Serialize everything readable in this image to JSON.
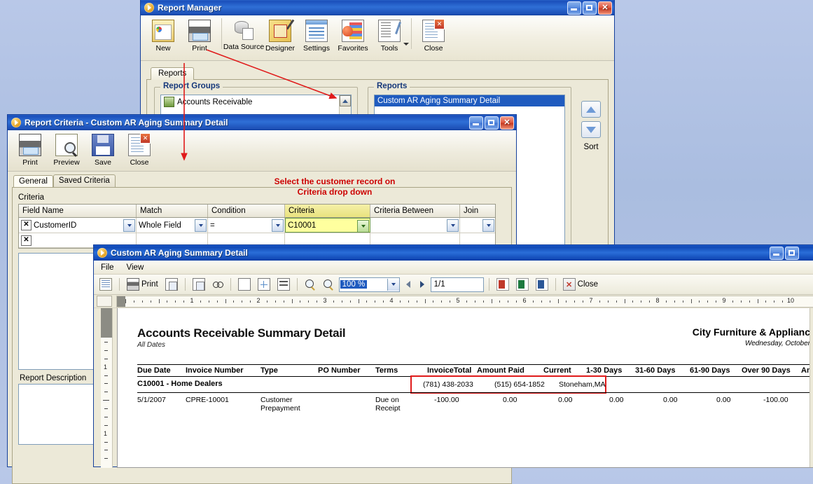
{
  "report_manager": {
    "title": "Report Manager",
    "toolbar": [
      {
        "label": "New",
        "icon": "new-report-icon"
      },
      {
        "label": "Print",
        "icon": "printer-icon"
      },
      {
        "label": "Data Source",
        "icon": "database-icon"
      },
      {
        "label": "Designer",
        "icon": "designer-icon"
      },
      {
        "label": "Settings",
        "icon": "settings-icon"
      },
      {
        "label": "Favorites",
        "icon": "favorites-icon"
      },
      {
        "label": "Tools",
        "icon": "tools-icon"
      },
      {
        "label": "Close",
        "icon": "close-document-icon"
      }
    ],
    "tab": "Reports",
    "report_groups": {
      "legend": "Report Groups",
      "items": [
        "Accounts Receivable"
      ]
    },
    "reports": {
      "legend": "Reports",
      "items": [
        "Custom AR Aging Summary Detail"
      ],
      "selected": "Custom AR Aging Summary Detail"
    },
    "sort_label": "Sort"
  },
  "report_criteria": {
    "title": "Report Criteria - Custom AR Aging Summary Detail",
    "toolbar": [
      {
        "label": "Print",
        "icon": "printer-icon"
      },
      {
        "label": "Preview",
        "icon": "preview-magnifier-icon"
      },
      {
        "label": "Save",
        "icon": "floppy-disk-icon"
      },
      {
        "label": "Close",
        "icon": "close-document-icon"
      }
    ],
    "tabs": [
      {
        "label": "General",
        "active": true
      },
      {
        "label": "Saved Criteria",
        "active": false
      }
    ],
    "annotation": "Select the customer record on\nCriteria drop down",
    "criteria_label": "Criteria",
    "grid": {
      "headers": [
        "Field Name",
        "Match",
        "Condition",
        "Criteria",
        "Criteria Between",
        "Join"
      ],
      "highlight_header": "Criteria",
      "rows": [
        {
          "field_name": "CustomerID",
          "match": "Whole Field",
          "condition": "=",
          "criteria": "C10001",
          "criteria_between": "",
          "join": ""
        },
        {
          "field_name": "",
          "match": "",
          "condition": "",
          "criteria": "",
          "criteria_between": "",
          "join": ""
        }
      ]
    },
    "description_label": "Report Description"
  },
  "report_viewer": {
    "title": "Custom AR Aging Summary Detail",
    "menu": [
      "File",
      "View"
    ],
    "toolbar": {
      "print_label": "Print",
      "zoom_value": "100 %",
      "page_value": "1/1",
      "close_label": "Close",
      "icons": [
        "document-outline-icon",
        "printer-icon",
        "page-setup-icon",
        "copy-icon",
        "find-icon",
        "single-page-icon",
        "multi-page-icon",
        "continuous-page-icon",
        "zoom-out-icon",
        "zoom-in-icon",
        "prev-page-icon",
        "next-page-icon",
        "export-pdf-icon",
        "export-excel-icon",
        "export-word-icon",
        "close-x-icon"
      ]
    },
    "ruler": {
      "h_numbers": [
        1,
        2,
        3,
        4,
        5,
        6,
        7,
        8,
        9,
        10
      ],
      "v_numbers": [
        1
      ]
    },
    "report": {
      "title": "Accounts Receivable Summary Detail",
      "subtitle": "All Dates",
      "company": "City Furniture & Applianc",
      "date": "Wednesday, October",
      "columns": [
        "Due Date",
        "Invoice Number",
        "Type",
        "PO Number",
        "Terms",
        "InvoiceTotal",
        "Amount Paid",
        "Current",
        "1-30 Days",
        "31-60 Days",
        "61-90 Days",
        "Over 90 Days",
        "Amou"
      ],
      "group_row": {
        "label": "C10001 - Home Dealers",
        "phone1": "(781) 438-2033",
        "phone2": "(515) 654-1852",
        "location": "Stoneham,MA"
      },
      "data_rows": [
        {
          "due_date": "5/1/2007",
          "invoice_number": "CPRE-10001",
          "type": "Customer\nPrepayment",
          "po_number": "",
          "terms": "Due on\nReceipt",
          "invoice_total": "-100.00",
          "amount_paid": "0.00",
          "current": "0.00",
          "days_1_30": "0.00",
          "days_31_60": "0.00",
          "days_61_90": "0.00",
          "over_90": "-100.00"
        }
      ]
    }
  },
  "colors": {
    "accent_blue": "#1b4fbb",
    "highlight_yellow": "#ffff9e",
    "annotation_red": "#cc0000",
    "selection_blue": "#1f5bbf"
  }
}
